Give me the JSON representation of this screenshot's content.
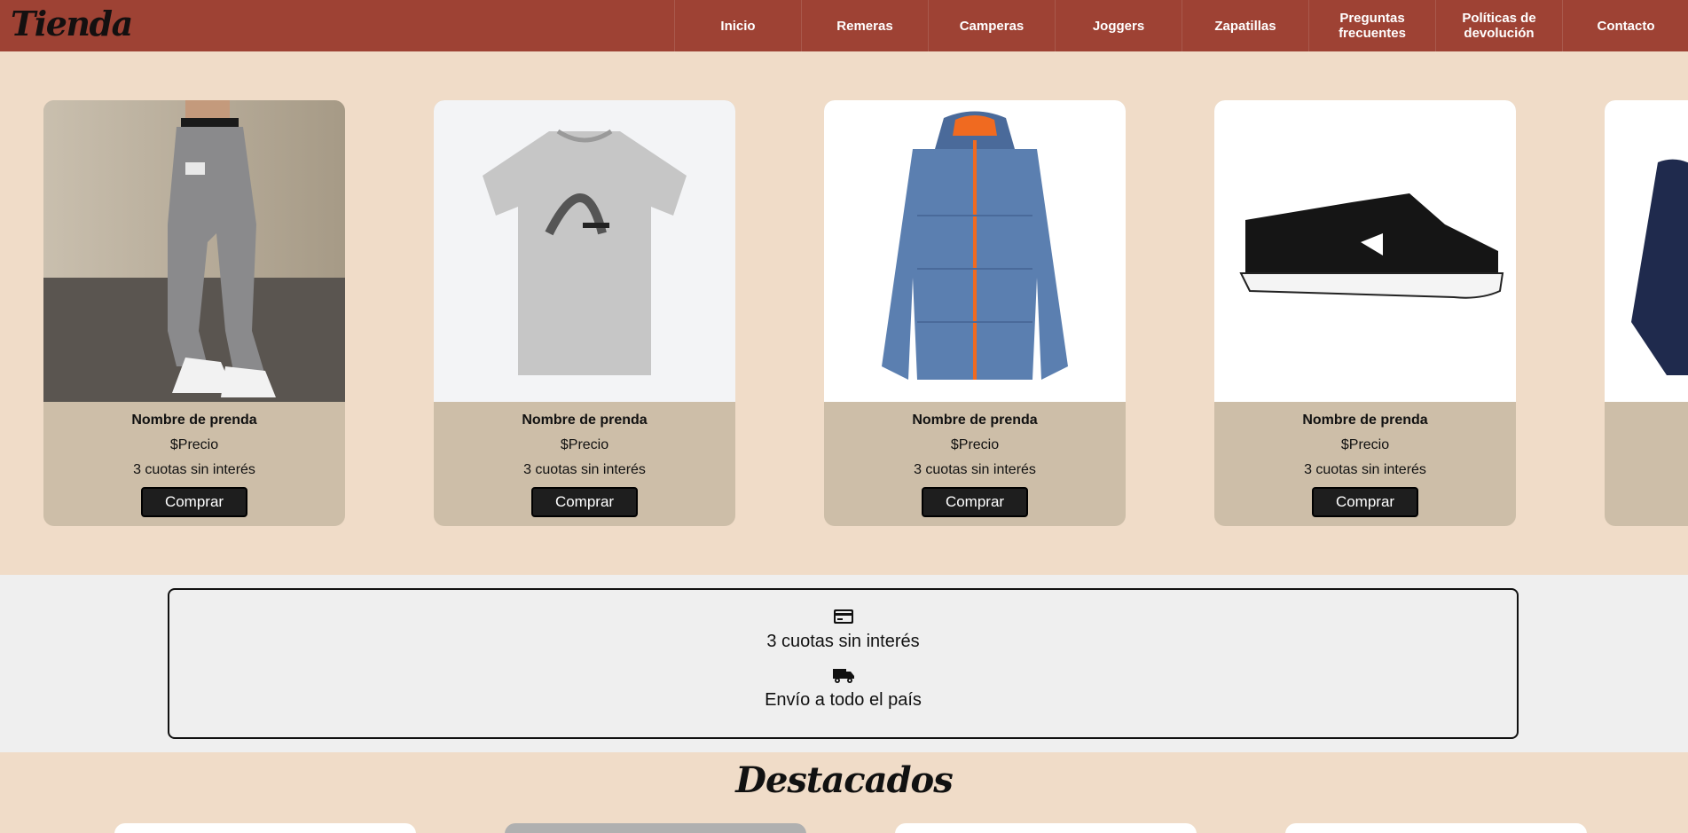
{
  "brand": {
    "logo_text": "Tienda"
  },
  "nav": {
    "items": [
      {
        "label": "Inicio"
      },
      {
        "label": "Remeras"
      },
      {
        "label": "Camperas"
      },
      {
        "label": "Joggers"
      },
      {
        "label": "Zapatillas"
      },
      {
        "label": "Preguntas frecuentes"
      },
      {
        "label": "Políticas de devolución"
      },
      {
        "label": "Contacto"
      }
    ]
  },
  "products": [
    {
      "name": "Nombre de prenda",
      "price": "$Precio",
      "installments": "3 cuotas sin interés",
      "buy_label": "Comprar",
      "image": "grey-jogger-pants-photo"
    },
    {
      "name": "Nombre de prenda",
      "price": "$Precio",
      "installments": "3 cuotas sin interés",
      "buy_label": "Comprar",
      "image": "grey-tshirt-photo"
    },
    {
      "name": "Nombre de prenda",
      "price": "$Precio",
      "installments": "3 cuotas sin interés",
      "buy_label": "Comprar",
      "image": "blue-puffer-jacket-photo"
    },
    {
      "name": "Nombre de prenda",
      "price": "$Precio",
      "installments": "3 cuotas sin interés",
      "buy_label": "Comprar",
      "image": "black-sneaker-photo"
    }
  ],
  "info": {
    "installments_icon": "credit-card-icon",
    "installments_text": "3 cuotas sin interés",
    "shipping_icon": "truck-icon",
    "shipping_text": "Envío a todo el país"
  },
  "featured": {
    "title": "Destacados"
  },
  "colors": {
    "navbar": "#9e4234",
    "page_bg": "#f0dcc8",
    "card_body": "#cdbea8",
    "button": "#1e1e1e",
    "info_bg": "#efefef"
  }
}
